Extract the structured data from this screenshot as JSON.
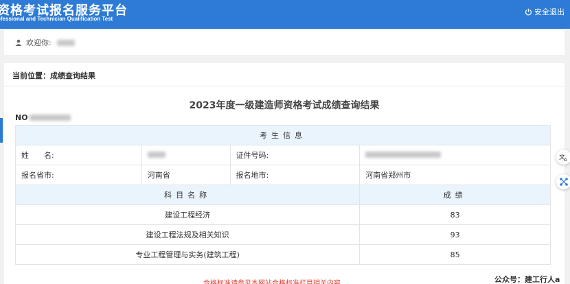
{
  "header": {
    "title": "资格考试报名服务平台",
    "subtitle": "ofessional and Technician Qualification Test",
    "logout_label": "安全退出"
  },
  "welcome": {
    "label": "欢迎你:"
  },
  "breadcrumb": {
    "label": "当前位置：成绩查询结果"
  },
  "page_title": "2023年度一级建造师资格考试成绩查询结果",
  "no_label": "NO",
  "info_table": {
    "section_header": "考生信息",
    "name_label": "姓　　名:",
    "id_label": "证件号码:",
    "province_label": "报名省市:",
    "province_value": "河南省",
    "location_label": "报名地市:",
    "location_value": "河南省郑州市"
  },
  "scores_table": {
    "subject_header": "科目名称",
    "score_header": "成绩",
    "rows": [
      {
        "subject": "建设工程经济",
        "score": "83"
      },
      {
        "subject": "建设工程法规及相关知识",
        "score": "93"
      },
      {
        "subject": "专业工程管理与实务(建筑工程)",
        "score": "85"
      }
    ]
  },
  "note": "合格标准请参见本网站合格标准栏目相关内容",
  "watermark": "公众号：建工行人a",
  "colors": {
    "header_blue": "#2d7bd4",
    "table_header_bg": "#eaf4fd",
    "note_red": "#e03c31"
  }
}
